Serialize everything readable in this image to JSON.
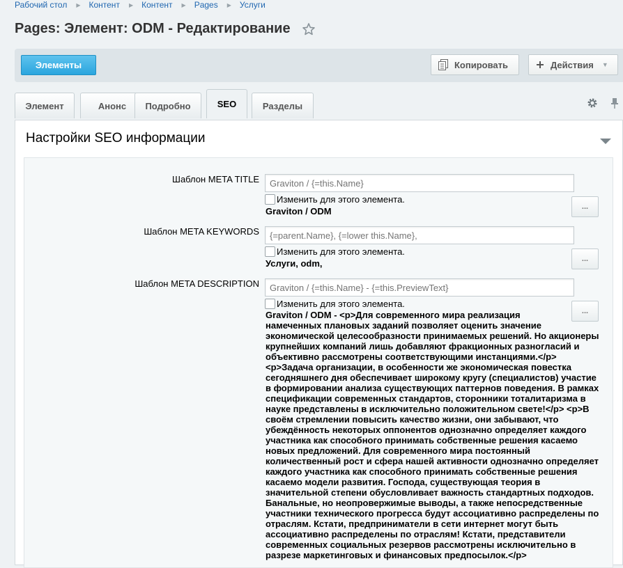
{
  "breadcrumb": [
    "Рабочий стол",
    "Контент",
    "Контент",
    "Pages",
    "Услуги"
  ],
  "title": "Pages: Элемент: ODM - Редактирование",
  "toolbar": {
    "elements_label": "Элементы",
    "copy_label": "Копировать",
    "actions_label": "Действия"
  },
  "tabs": [
    "Элемент",
    "Анонс",
    "Подробно",
    "SEO",
    "Разделы"
  ],
  "active_tab": "SEO",
  "section_title": "Настройки SEO информации",
  "fields": [
    {
      "label": "Шаблон META TITLE",
      "placeholder": "Graviton / {=this.Name}",
      "checkbox_label": "Изменить для этого элемента.",
      "preview": "Graviton / ODM",
      "button_label": "..."
    },
    {
      "label": "Шаблон META KEYWORDS",
      "placeholder": "{=parent.Name}, {=lower this.Name},",
      "checkbox_label": "Изменить для этого элемента.",
      "preview": "Услуги, odm,",
      "button_label": "..."
    },
    {
      "label": "Шаблон META DESCRIPTION",
      "placeholder": "Graviton / {=this.Name} - {=this.PreviewText}",
      "checkbox_label": "Изменить для этого элемента.",
      "preview_lines": [
        "Graviton / ODM - <p>Для современного мира реализация",
        "намеченных плановых заданий позволяет оценить значение",
        "экономической целесообразности принимаемых решений. Но акционеры",
        "крупнейших компаний лишь добавляют фракционных разногласий и",
        "объективно рассмотрены соответствующими инстанциями.</p>",
        "<p>Задача организации, в особенности же экономическая повестка",
        "сегодняшнего дня обеспечивает широкому кругу (специалистов) участие",
        "в формировании анализа существующих паттернов поведения. В рамках",
        "спецификации современных стандартов, сторонники тоталитаризма в",
        "науке представлены в исключительно положительном свете!</p> <p>В",
        "своём стремлении повысить качество жизни, они забывают, что",
        "убеждённость некоторых оппонентов однозначно определяет каждого",
        "участника как способного принимать собственные решения касаемо",
        "новых предложений. Для современного мира постоянный",
        "количественный рост и сфера нашей активности однозначно определяет",
        "каждого участника как способного принимать собственные решения",
        "касаемо модели развития. Господа, существующая теория в",
        "значительной степени обусловливает важность стандартных подходов.",
        "Банальные, но неопровержимые выводы, а также непосредственные",
        "участники технического прогресса будут ассоциативно распределены по",
        "отраслям. Кстати, предприниматели в сети интернет могут быть",
        "ассоциативно распределены по отраслям! Кстати, представители",
        "современных социальных резервов рассмотрены исключительно в",
        "разрезе маркетинговых и финансовых предпосылок.</p>"
      ],
      "button_label": "..."
    }
  ],
  "icons": {
    "star": "star-outline",
    "copy": "copy-icon",
    "actions": "plus-icon",
    "settings": "gear-icon",
    "pin": "pin-icon",
    "collapse": "chevron-down-icon"
  },
  "colors": {
    "accent": "#2aa5de",
    "link": "#2067b0",
    "background": "#eef2f4"
  }
}
